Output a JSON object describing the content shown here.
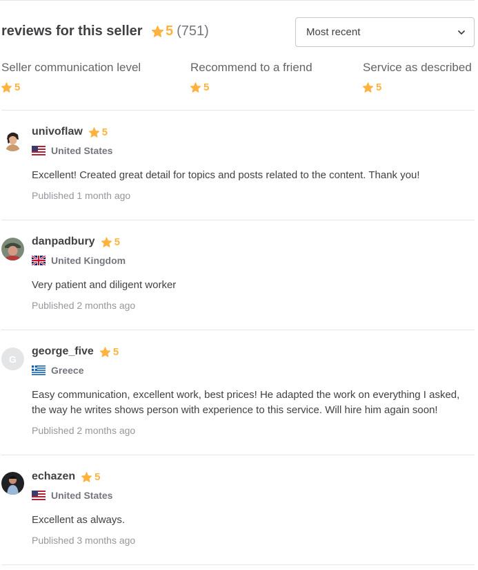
{
  "header": {
    "title": "reviews for this seller",
    "score": "5",
    "count": "(751)"
  },
  "sort": {
    "selected": "Most recent"
  },
  "breakdown": [
    {
      "label": "Seller communication level",
      "score": "5"
    },
    {
      "label": "Recommend to a friend",
      "score": "5"
    },
    {
      "label": "Service as described",
      "score": "5"
    }
  ],
  "reviews": [
    {
      "username": "univoflaw",
      "score": "5",
      "country": "United States",
      "text": "Excellent! Created great detail for topics and posts related to the content. Thank you!",
      "published": "Published 1 month ago"
    },
    {
      "username": "danpadbury",
      "score": "5",
      "country": "United Kingdom",
      "text": "Very patient and diligent worker",
      "published": "Published 2 months ago"
    },
    {
      "username": "george_five",
      "avatar_letter": "G",
      "score": "5",
      "country": "Greece",
      "text": "Easy communication, excellent work, best prices! He adapted the work on everything I asked, the way he writes shows person with experience to this service. Will hire him again soon!",
      "published": "Published 2 months ago"
    },
    {
      "username": "echazen",
      "score": "5",
      "country": "United States",
      "text": "Excellent as always.",
      "published": "Published 3 months ago"
    }
  ],
  "colors": {
    "star": "#ffb33e",
    "text": "#404145",
    "muted": "#95979d",
    "divider": "#e4e5e7"
  }
}
